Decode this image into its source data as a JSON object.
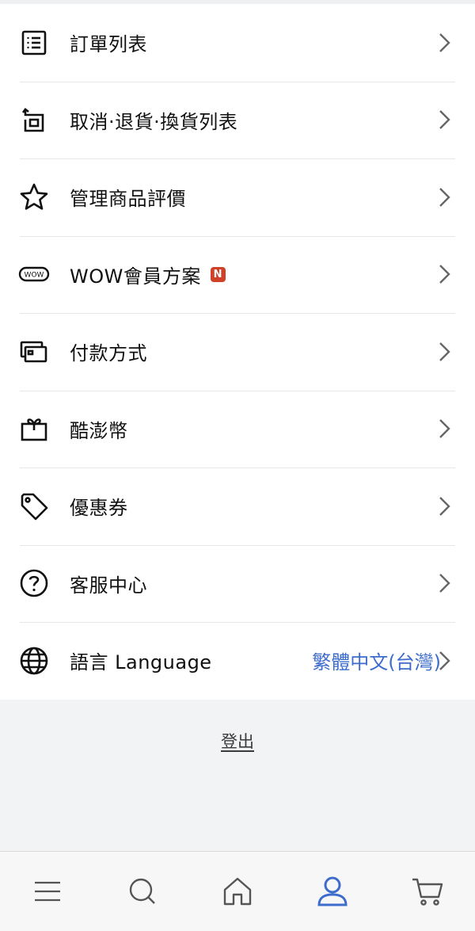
{
  "menu": {
    "items": [
      {
        "label": "訂單列表",
        "icon": "order-list-icon"
      },
      {
        "label": "取消·退貨·換貨列表",
        "icon": "return-box-icon"
      },
      {
        "label": "管理商品評價",
        "icon": "star-icon"
      },
      {
        "label": "WOW會員方案",
        "icon": "wow-badge-icon",
        "badge": "N",
        "wow_text": "WOW"
      },
      {
        "label": "付款方式",
        "icon": "payment-card-icon"
      },
      {
        "label": "酷澎幣",
        "icon": "gift-box-icon"
      },
      {
        "label": "優惠券",
        "icon": "tag-icon"
      },
      {
        "label": "客服中心",
        "icon": "help-circle-icon"
      },
      {
        "label": "語言 Language",
        "icon": "globe-icon",
        "value": "繁體中文(台灣)"
      }
    ]
  },
  "logout": {
    "label": "登出"
  },
  "tabbar": {
    "tabs": [
      {
        "name": "menu",
        "icon": "hamburger-icon"
      },
      {
        "name": "search",
        "icon": "search-icon"
      },
      {
        "name": "home",
        "icon": "home-icon"
      },
      {
        "name": "account",
        "icon": "user-icon",
        "active": true
      },
      {
        "name": "cart",
        "icon": "cart-icon"
      }
    ]
  },
  "colors": {
    "accent": "#3d6ccc",
    "badge": "#d0412a",
    "divider": "#e6e7e9",
    "background": "#f2f3f5"
  }
}
